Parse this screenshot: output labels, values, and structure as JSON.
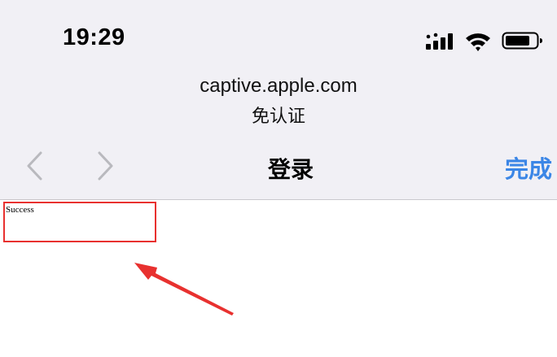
{
  "status_bar": {
    "time": "19:29"
  },
  "browser": {
    "url": "captive.apple.com",
    "subtitle": "免认证"
  },
  "nav_bar": {
    "title": "登录",
    "done_label": "完成"
  },
  "page": {
    "content_text": "Success"
  },
  "colors": {
    "accent": "#3b86e6",
    "annotation": "#e8312f",
    "bar_background": "#f1f0f5"
  }
}
